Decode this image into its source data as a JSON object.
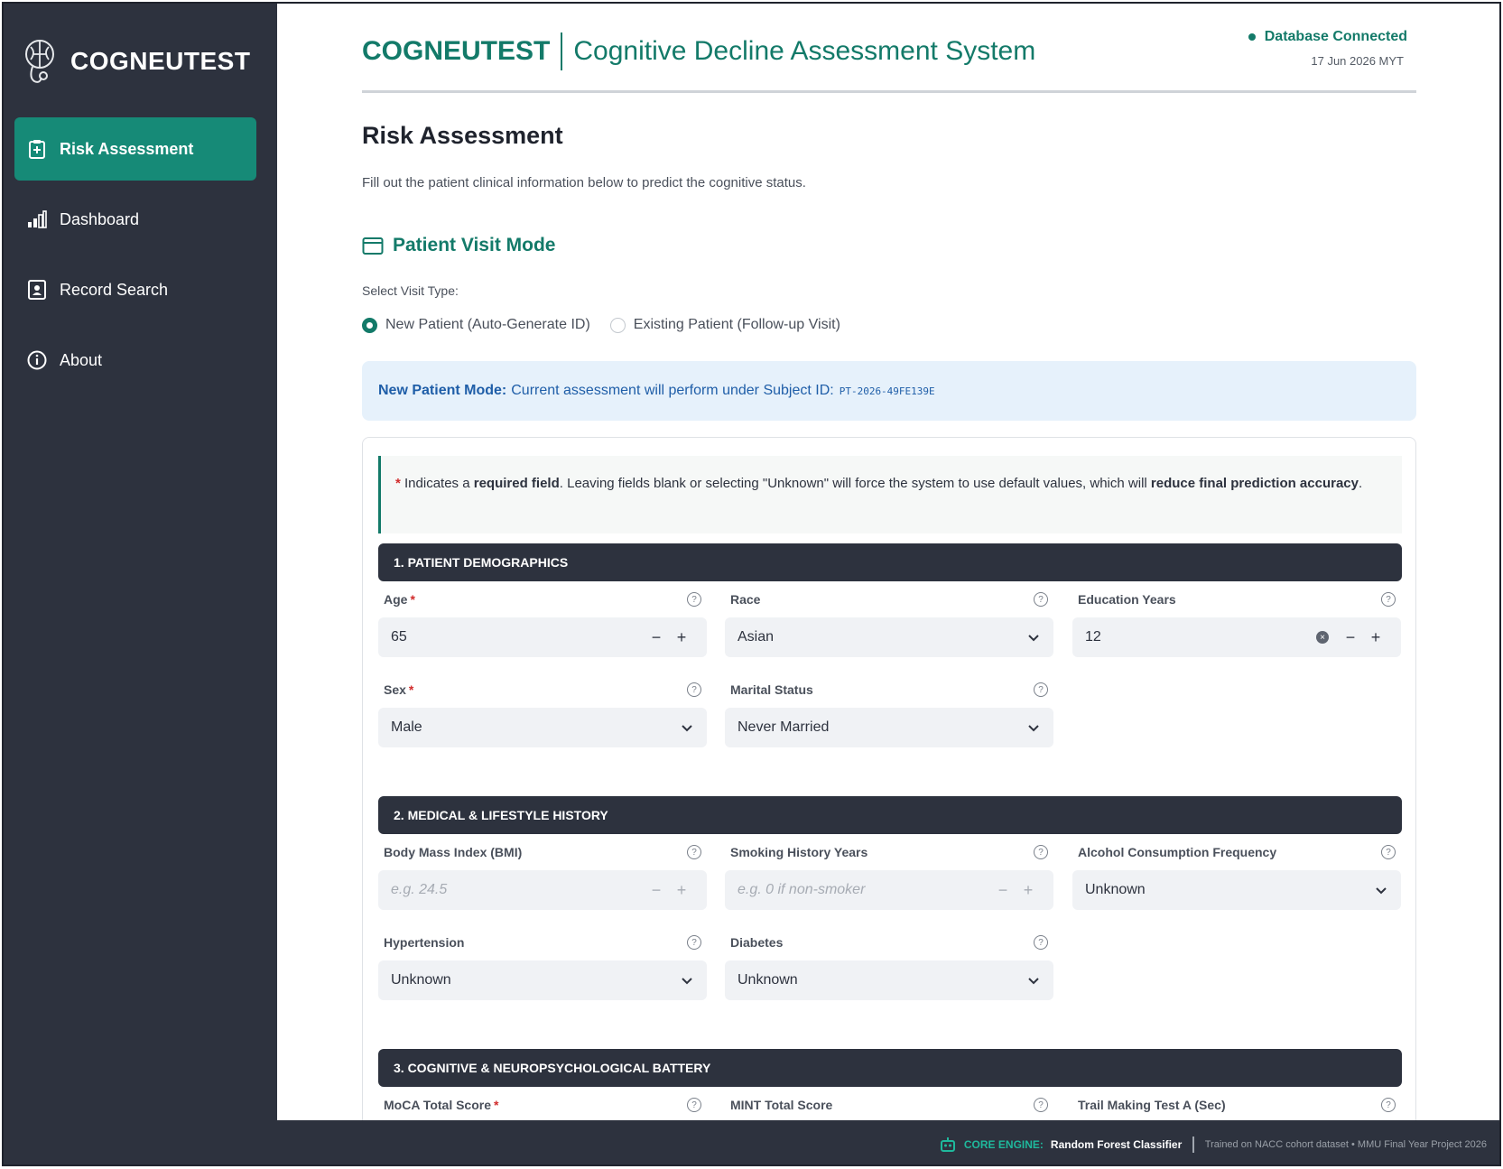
{
  "brand": {
    "name": "COGNEUTEST",
    "logo_icon": "brain-stethoscope-icon"
  },
  "sidebar": {
    "items": [
      {
        "label": "Risk Assessment",
        "icon": "clipboard-icon",
        "active": true
      },
      {
        "label": "Dashboard",
        "icon": "bar-chart-icon",
        "active": false
      },
      {
        "label": "Record Search",
        "icon": "contact-card-icon",
        "active": false
      },
      {
        "label": "About",
        "icon": "info-icon",
        "active": false
      }
    ]
  },
  "header": {
    "title": "COGNEUTEST",
    "subtitle": "Cognitive Decline Assessment System",
    "db_status": "Database Connected",
    "date": "17 Jun 2026 MYT"
  },
  "page": {
    "title": "Risk Assessment",
    "description": "Fill out the patient clinical information below to predict the cognitive status."
  },
  "visit": {
    "heading": "Patient Visit Mode",
    "label": "Select Visit Type:",
    "options": [
      "New Patient (Auto-Generate ID)",
      "Existing Patient (Follow-up Visit)"
    ],
    "selected": "New Patient (Auto-Generate ID)"
  },
  "info": {
    "bold": "New Patient Mode:",
    "text": "Current assessment will perform under Subject ID:",
    "subject_id": "PT-2026-49FE139E"
  },
  "note": {
    "star": "*",
    "t1": "Indicates a",
    "b1": "required field",
    "t2": ". Leaving fields blank or selecting \"Unknown\" will force the system to use default values, which will",
    "b2": "reduce final prediction accuracy",
    "t3": "."
  },
  "sections": {
    "s1": "1. Patient Demographics",
    "s2": "2. Medical & Lifestyle History",
    "s3": "3. Cognitive & Neuropsychological Battery"
  },
  "fields": {
    "age": {
      "label": "Age",
      "value": "65",
      "required": true
    },
    "race": {
      "label": "Race",
      "value": "Asian"
    },
    "education": {
      "label": "Education Years",
      "value": "12"
    },
    "sex": {
      "label": "Sex",
      "value": "Male",
      "required": true
    },
    "marital": {
      "label": "Marital Status",
      "value": "Never Married"
    },
    "bmi": {
      "label": "Body Mass Index (BMI)",
      "placeholder": "e.g. 24.5"
    },
    "smoking": {
      "label": "Smoking History Years",
      "placeholder": "e.g. 0 if non-smoker"
    },
    "alcohol": {
      "label": "Alcohol Consumption Frequency",
      "value": "Unknown"
    },
    "hypertension": {
      "label": "Hypertension",
      "value": "Unknown"
    },
    "diabetes": {
      "label": "Diabetes",
      "value": "Unknown"
    },
    "moca": {
      "label": "MoCA Total Score",
      "required": true
    },
    "mint": {
      "label": "MINT Total Score"
    },
    "trail": {
      "label": "Trail Making Test A (Sec)"
    }
  },
  "symbols": {
    "minus": "−",
    "plus": "+",
    "help": "?",
    "clear": "×",
    "star": "*"
  },
  "footer": {
    "engine_label": "CORE ENGINE:",
    "model": "Random Forest Classifier",
    "meta": "Trained on NACC cohort dataset • MMU Final Year Project 2026"
  },
  "colors": {
    "accent": "#137a69",
    "sidebar": "#2d323e",
    "active": "#168a77",
    "info_bg": "#e6f1fb"
  }
}
